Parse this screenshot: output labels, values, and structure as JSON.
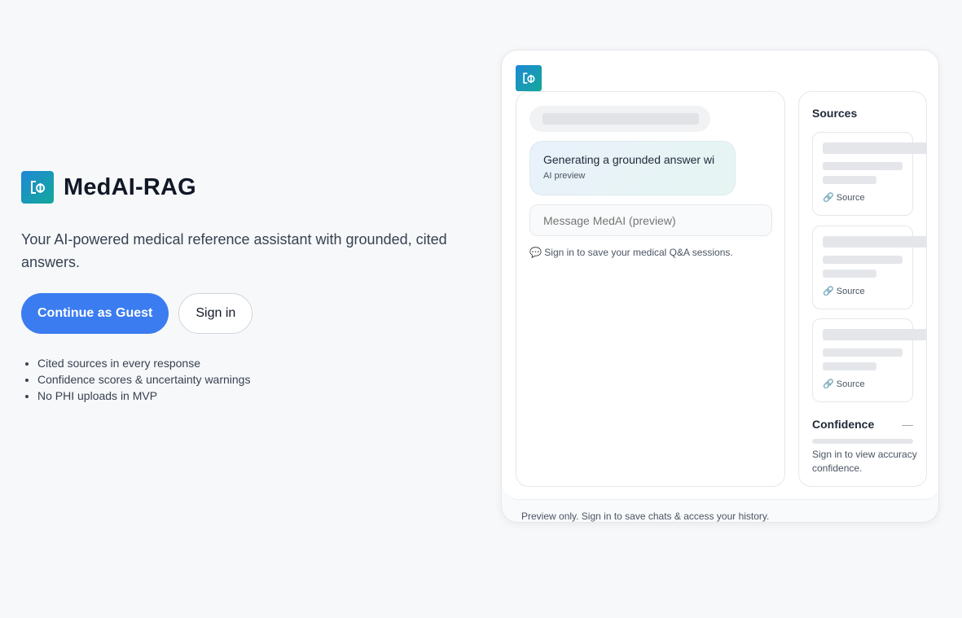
{
  "brand": {
    "title": "MedAI-RAG",
    "logo_icon": "medai-logo-icon",
    "primary_color": "#3b7cf0"
  },
  "tagline": "Your AI-powered medical reference assistant with grounded, cited answers.",
  "actions": {
    "guest_label": "Continue as Guest",
    "signin_label": "Sign in"
  },
  "features": [
    "Cited sources in every response",
    "Confidence scores & uncertainty warnings",
    "No PHI uploads in MVP"
  ],
  "preview": {
    "ai_message": "Generating a grounded answer wi",
    "ai_caption": "AI preview",
    "input_placeholder": "Message MedAI (preview)",
    "signin_note": "💬 Sign in to save your medical Q&A sessions.",
    "sources_title": "Sources",
    "sources": [
      {
        "link_label": "🔗 Source"
      },
      {
        "link_label": "🔗 Source"
      },
      {
        "link_label": "🔗 Source"
      }
    ],
    "confidence_title": "Confidence",
    "confidence_value": "—",
    "confidence_note": "Sign in to view accuracy confidence.",
    "footer": "Preview only. Sign in to save chats & access your history."
  }
}
